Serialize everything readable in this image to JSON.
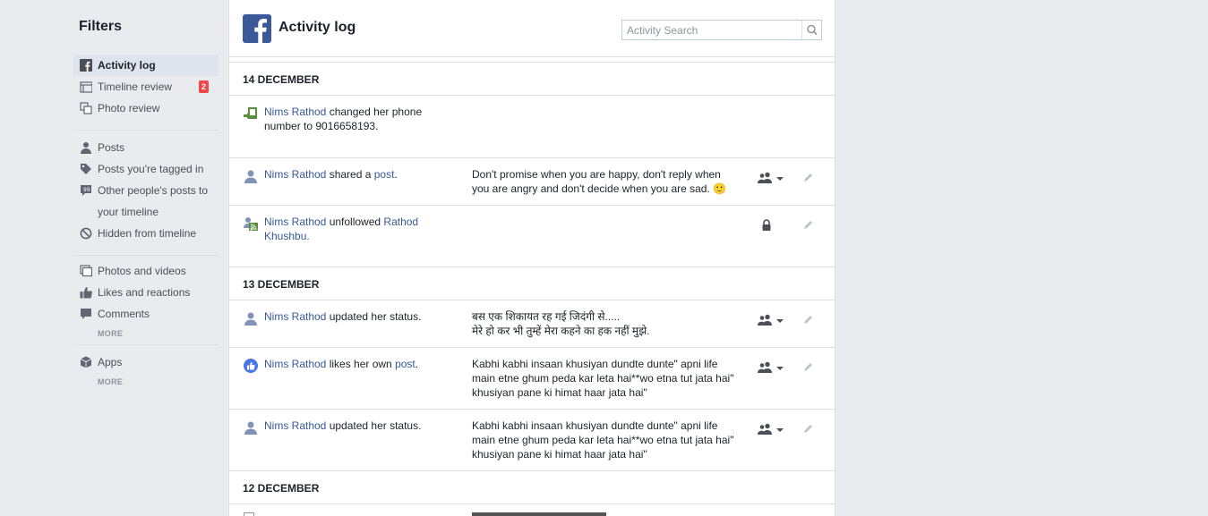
{
  "sidebar": {
    "title": "Filters",
    "group1": [
      {
        "label": "Activity log",
        "icon": "facebook-icon",
        "active": true
      },
      {
        "label": "Timeline review",
        "icon": "timeline-icon",
        "badge": "2"
      },
      {
        "label": "Photo review",
        "icon": "photos-icon"
      }
    ],
    "group2": [
      {
        "label": "Posts",
        "icon": "person-icon"
      },
      {
        "label": "Posts you're tagged in",
        "icon": "tag-icon"
      },
      {
        "label": "Other people's posts to",
        "icon": "speech-bubble-icon"
      },
      {
        "label": "your timeline"
      },
      {
        "label": "Hidden from timeline",
        "icon": "no-entry-icon"
      }
    ],
    "group3": [
      {
        "label": "Photos and videos",
        "icon": "photos-icon"
      },
      {
        "label": "Likes and reactions",
        "icon": "thumbs-up-icon"
      },
      {
        "label": "Comments",
        "icon": "comment-icon"
      }
    ],
    "more1": "MORE",
    "group4": [
      {
        "label": "Apps",
        "icon": "cube-icon"
      }
    ],
    "more2": "MORE"
  },
  "header": {
    "title": "Activity log",
    "search_placeholder": "Activity Search"
  },
  "sections": [
    {
      "date": "14 DECEMBER",
      "rows": [
        {
          "actor": "Nims Rathod",
          "action": " changed her phone number to 9016658193.",
          "body": ""
        },
        {
          "actor": "Nims Rathod",
          "action": " shared a ",
          "target": "post",
          "suffix": ".",
          "body": "Don't promise when you are happy, don't reply when you are angry and don't decide when you are sad. 🙂"
        },
        {
          "actor": "Nims Rathod",
          "action": " unfollowed ",
          "target": "Rathod Khushbu",
          "suffix": ".",
          "body": ""
        }
      ]
    },
    {
      "date": "13 DECEMBER",
      "rows": [
        {
          "actor": "Nims Rathod",
          "action": " updated her status.",
          "body": "बस एक शिकायत रह गई जिदंगी से.....\nमेरे हो कर भी तुम्हें मेरा कहने का हक नहीं मुझे."
        },
        {
          "actor": "Nims Rathod",
          "action": " likes her own ",
          "target": "post",
          "suffix": ".",
          "body": "Kabhi kabhi insaan khusiyan dundte dunte\" apni life main etne ghum peda kar leta hai**wo etna tut jata hai\" khusiyan pane ki himat haar jata hai\""
        },
        {
          "actor": "Nims Rathod",
          "action": " updated her status.",
          "body": "Kabhi kabhi insaan khusiyan dundte dunte\" apni life main etne ghum peda kar leta hai**wo etna tut jata hai\" khusiyan pane ki himat haar jata hai\""
        }
      ]
    },
    {
      "date": "12 DECEMBER",
      "rows": []
    }
  ],
  "colors": {
    "brand": "#3b5998",
    "link": "#365899",
    "badge": "#f0484a"
  }
}
